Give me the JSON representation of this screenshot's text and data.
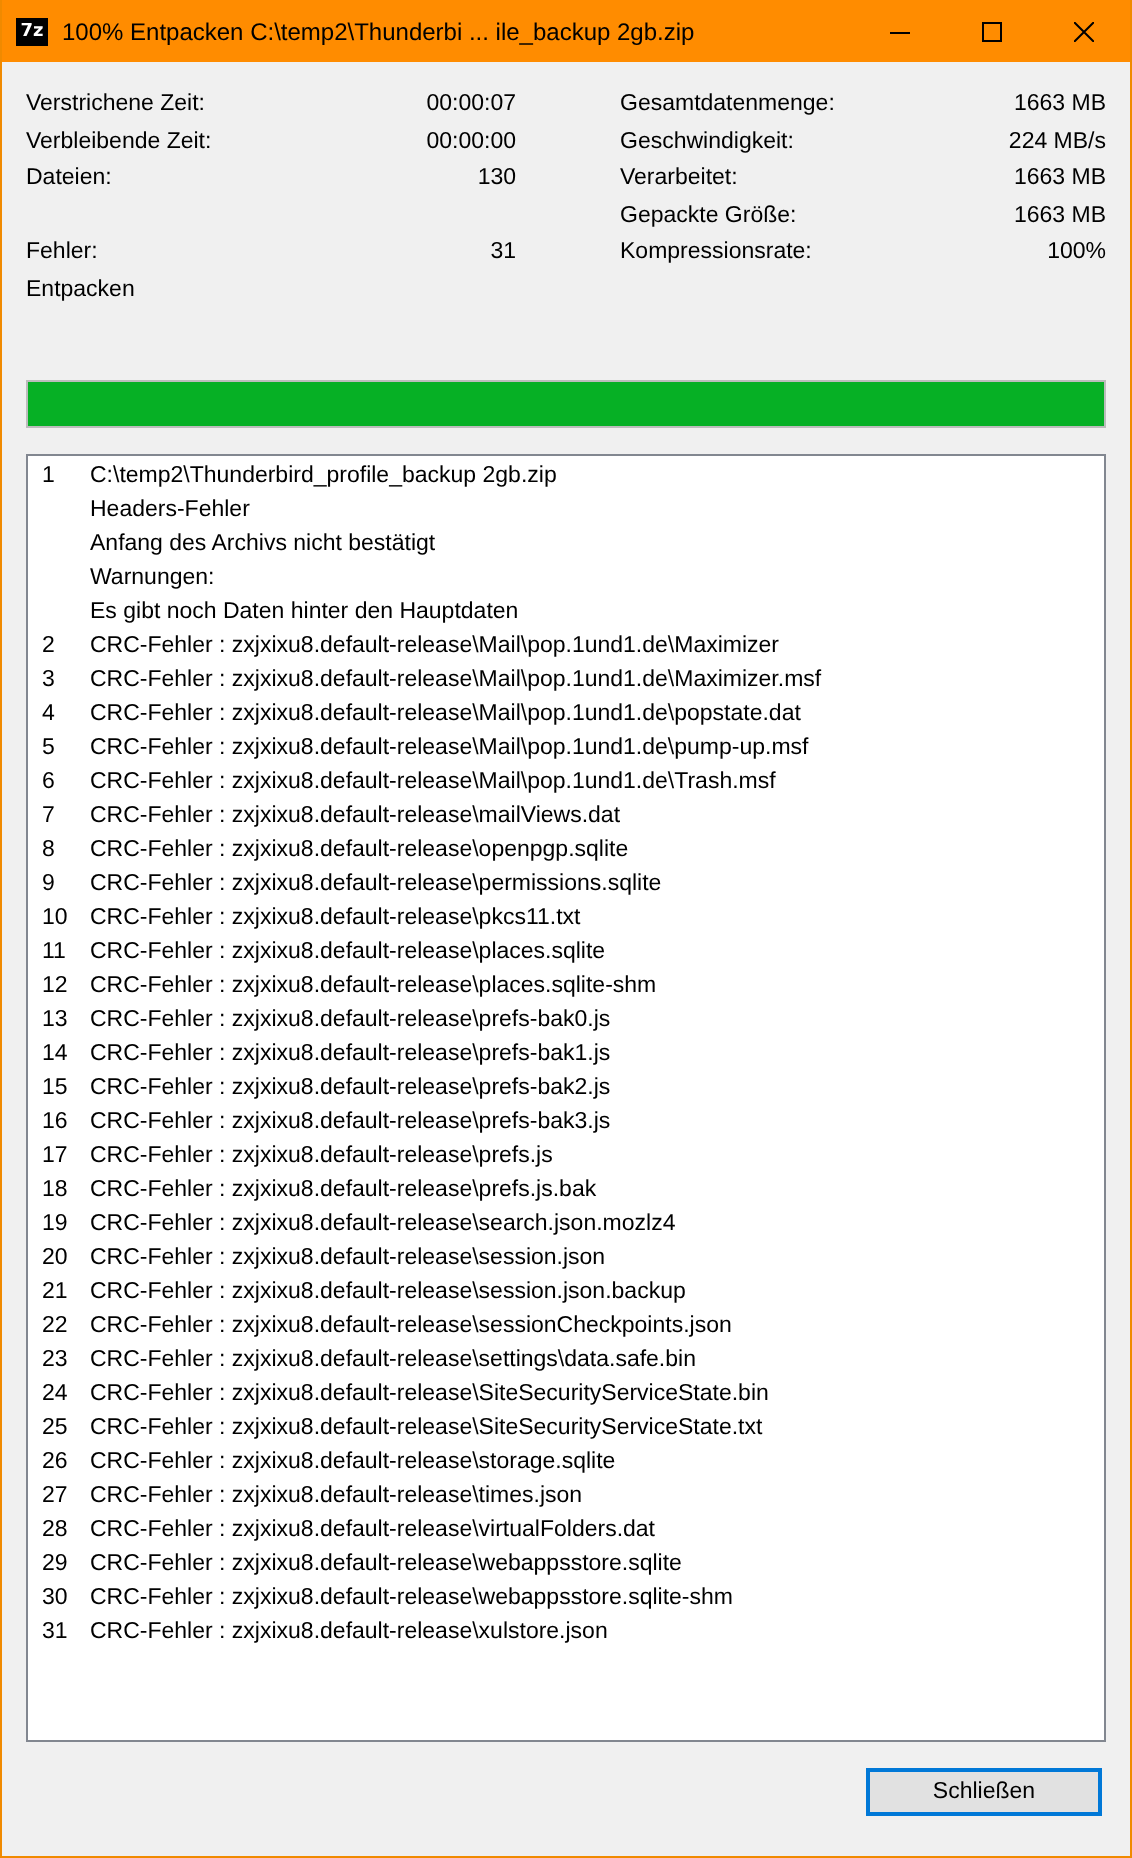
{
  "window": {
    "icon_label": "7z",
    "title": "100% Entpacken C:\\temp2\\Thunderbi ... ile_backup 2gb.zip"
  },
  "stats": [
    {
      "left": {
        "label": "Verstrichene Zeit:",
        "value": "00:00:07"
      },
      "right": {
        "label": "Gesamtdatenmenge:",
        "value": "1663 MB"
      }
    },
    {
      "left": {
        "label": "Verbleibende Zeit:",
        "value": "00:00:00"
      },
      "right": {
        "label": "Geschwindigkeit:",
        "value": "224 MB/s"
      }
    },
    {
      "left": {
        "label": "Dateien:",
        "value": "130"
      },
      "right": {
        "label": "Verarbeitet:",
        "value": "1663 MB"
      }
    },
    {
      "right": {
        "label": "Gepackte Größe:",
        "value": "1663 MB"
      }
    },
    {
      "left": {
        "label": "Fehler:",
        "value": "31"
      },
      "right": {
        "label": "Kompressionsrate:",
        "value": "100%"
      }
    }
  ],
  "operation": "Entpacken",
  "progress": {
    "level": 1
  },
  "messages": [
    {
      "number": "1",
      "lines": [
        "C:\\temp2\\Thunderbird_profile_backup 2gb.zip",
        "Headers-Fehler",
        "Anfang des Archivs nicht bestätigt",
        "Warnungen:",
        "Es gibt noch Daten hinter den Hauptdaten"
      ]
    },
    {
      "number": "2",
      "lines": [
        "CRC-Fehler : zxjxixu8.default-release\\Mail\\pop.1und1.de\\Maximizer"
      ]
    },
    {
      "number": "3",
      "lines": [
        "CRC-Fehler : zxjxixu8.default-release\\Mail\\pop.1und1.de\\Maximizer.msf"
      ]
    },
    {
      "number": "4",
      "lines": [
        "CRC-Fehler : zxjxixu8.default-release\\Mail\\pop.1und1.de\\popstate.dat"
      ]
    },
    {
      "number": "5",
      "lines": [
        "CRC-Fehler : zxjxixu8.default-release\\Mail\\pop.1und1.de\\pump-up.msf"
      ]
    },
    {
      "number": "6",
      "lines": [
        "CRC-Fehler : zxjxixu8.default-release\\Mail\\pop.1und1.de\\Trash.msf"
      ]
    },
    {
      "number": "7",
      "lines": [
        "CRC-Fehler : zxjxixu8.default-release\\mailViews.dat"
      ]
    },
    {
      "number": "8",
      "lines": [
        "CRC-Fehler : zxjxixu8.default-release\\openpgp.sqlite"
      ]
    },
    {
      "number": "9",
      "lines": [
        "CRC-Fehler : zxjxixu8.default-release\\permissions.sqlite"
      ]
    },
    {
      "number": "10",
      "lines": [
        "CRC-Fehler : zxjxixu8.default-release\\pkcs11.txt"
      ]
    },
    {
      "number": "11",
      "lines": [
        "CRC-Fehler : zxjxixu8.default-release\\places.sqlite"
      ]
    },
    {
      "number": "12",
      "lines": [
        "CRC-Fehler : zxjxixu8.default-release\\places.sqlite-shm"
      ]
    },
    {
      "number": "13",
      "lines": [
        "CRC-Fehler : zxjxixu8.default-release\\prefs-bak0.js"
      ]
    },
    {
      "number": "14",
      "lines": [
        "CRC-Fehler : zxjxixu8.default-release\\prefs-bak1.js"
      ]
    },
    {
      "number": "15",
      "lines": [
        "CRC-Fehler : zxjxixu8.default-release\\prefs-bak2.js"
      ]
    },
    {
      "number": "16",
      "lines": [
        "CRC-Fehler : zxjxixu8.default-release\\prefs-bak3.js"
      ]
    },
    {
      "number": "17",
      "lines": [
        "CRC-Fehler : zxjxixu8.default-release\\prefs.js"
      ]
    },
    {
      "number": "18",
      "lines": [
        "CRC-Fehler : zxjxixu8.default-release\\prefs.js.bak"
      ]
    },
    {
      "number": "19",
      "lines": [
        "CRC-Fehler : zxjxixu8.default-release\\search.json.mozlz4"
      ]
    },
    {
      "number": "20",
      "lines": [
        "CRC-Fehler : zxjxixu8.default-release\\session.json"
      ]
    },
    {
      "number": "21",
      "lines": [
        "CRC-Fehler : zxjxixu8.default-release\\session.json.backup"
      ]
    },
    {
      "number": "22",
      "lines": [
        "CRC-Fehler : zxjxixu8.default-release\\sessionCheckpoints.json"
      ]
    },
    {
      "number": "23",
      "lines": [
        "CRC-Fehler : zxjxixu8.default-release\\settings\\data.safe.bin"
      ]
    },
    {
      "number": "24",
      "lines": [
        "CRC-Fehler : zxjxixu8.default-release\\SiteSecurityServiceState.bin"
      ]
    },
    {
      "number": "25",
      "lines": [
        "CRC-Fehler : zxjxixu8.default-release\\SiteSecurityServiceState.txt"
      ]
    },
    {
      "number": "26",
      "lines": [
        "CRC-Fehler : zxjxixu8.default-release\\storage.sqlite"
      ]
    },
    {
      "number": "27",
      "lines": [
        "CRC-Fehler : zxjxixu8.default-release\\times.json"
      ]
    },
    {
      "number": "28",
      "lines": [
        "CRC-Fehler : zxjxixu8.default-release\\virtualFolders.dat"
      ]
    },
    {
      "number": "29",
      "lines": [
        "CRC-Fehler : zxjxixu8.default-release\\webappsstore.sqlite"
      ]
    },
    {
      "number": "30",
      "lines": [
        "CRC-Fehler : zxjxixu8.default-release\\webappsstore.sqlite-shm"
      ]
    },
    {
      "number": "31",
      "lines": [
        "CRC-Fehler : zxjxixu8.default-release\\xulstore.json"
      ]
    }
  ],
  "buttons": [
    {
      "label": "Schließen"
    }
  ]
}
